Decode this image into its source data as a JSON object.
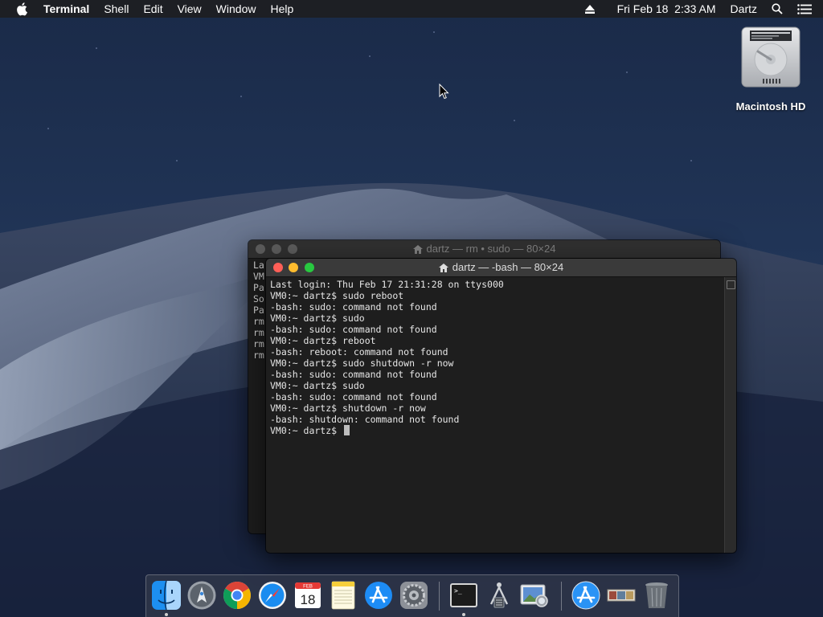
{
  "menubar": {
    "app_name": "Terminal",
    "items": [
      "Shell",
      "Edit",
      "View",
      "Window",
      "Help"
    ],
    "clock": "Fri Feb 18  2:33 AM",
    "user": "Dartz"
  },
  "desktop": {
    "hd_label": "Macintosh HD"
  },
  "back_window": {
    "title": "dartz — rm • sudo — 80×24",
    "visible_fragments": [
      "La",
      "VM",
      "Pa",
      "So",
      "Pa",
      "rm",
      "rm",
      "rm",
      "rm"
    ]
  },
  "front_window": {
    "title": "dartz — -bash — 80×24",
    "lines": [
      "Last login: Thu Feb 17 21:31:28 on ttys000",
      "VM0:~ dartz$ sudo reboot",
      "-bash: sudo: command not found",
      "VM0:~ dartz$ sudo",
      "-bash: sudo: command not found",
      "VM0:~ dartz$ reboot",
      "-bash: reboot: command not found",
      "VM0:~ dartz$ sudo shutdown -r now",
      "-bash: sudo: command not found",
      "VM0:~ dartz$ sudo",
      "-bash: sudo: command not found",
      "VM0:~ dartz$ shutdown -r now",
      "-bash: shutdown: command not found"
    ],
    "prompt": "VM0:~ dartz$ "
  },
  "calendar": {
    "month": "FEB",
    "day": "18"
  },
  "dock": {
    "apps": [
      "finder-icon",
      "launchpad-icon",
      "chrome-icon",
      "safari-icon",
      "calendar-icon",
      "notes-icon",
      "app-store-icon",
      "system-preferences-icon",
      "terminal-icon",
      "directory-utility-icon",
      "preview-icon",
      "app-store-downloads-icon",
      "photos-stack-icon",
      "trash-icon"
    ]
  },
  "colors": {
    "menubar_bg": "#1d1f24",
    "terminal_bg": "#1e1e1e",
    "close": "#ff5f57",
    "minimize": "#febc2e",
    "zoom": "#28c840"
  }
}
